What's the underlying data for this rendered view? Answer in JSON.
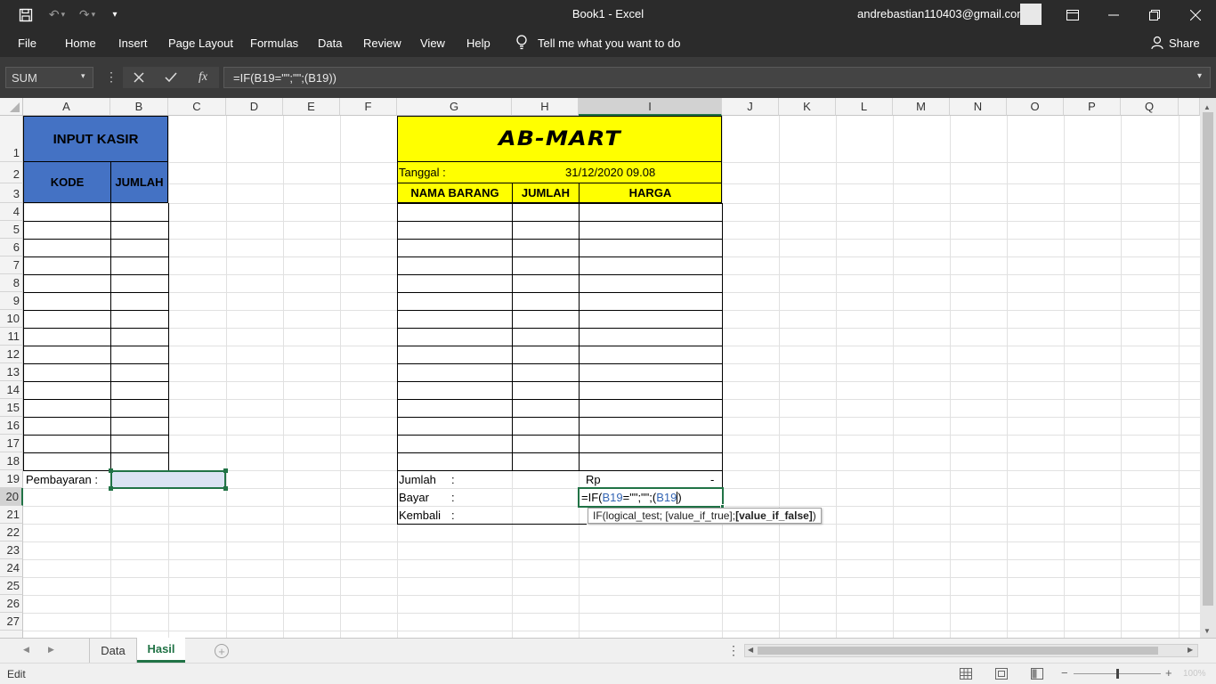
{
  "window": {
    "title": "Book1  -  Excel",
    "account": "andrebastian110403@gmail.com"
  },
  "ribbon": {
    "tabs": [
      "File",
      "Home",
      "Insert",
      "Page Layout",
      "Formulas",
      "Data",
      "Review",
      "View",
      "Help"
    ],
    "tell_me": "Tell me what you want to do",
    "share": "Share"
  },
  "formula_bar": {
    "name_box": "SUM",
    "fx": "fx",
    "formula": "=IF(B19=\"\";\"\";(B19))"
  },
  "columns": [
    "A",
    "B",
    "C",
    "D",
    "E",
    "F",
    "G",
    "H",
    "I",
    "J",
    "K",
    "L",
    "M",
    "N",
    "O",
    "P",
    "Q"
  ],
  "rows": [
    "1",
    "2",
    "3",
    "4",
    "5",
    "6",
    "7",
    "8",
    "9",
    "10",
    "11",
    "12",
    "13",
    "14",
    "15",
    "16",
    "17",
    "18",
    "19",
    "20",
    "21",
    "22",
    "23",
    "24",
    "25",
    "26",
    "27"
  ],
  "input_kasir": {
    "title": "INPUT KASIR",
    "col_kode": "KODE",
    "col_jumlah": "JUMLAH",
    "pembayaran_label": "Pembayaran :"
  },
  "receipt": {
    "store": "AB-MART",
    "tanggal_label": "Tanggal :",
    "tanggal_value": "31/12/2020 09.08",
    "col_nama": "NAMA BARANG",
    "col_jumlah": "JUMLAH",
    "col_harga": "HARGA",
    "jumlah_label": "Jumlah",
    "bayar_label": "Bayar",
    "kembali_label": "Kembali",
    "colon": ":",
    "rp": "Rp",
    "dash": "-",
    "edit_prefix": "=IF(",
    "edit_ref1": "B19",
    "edit_mid": "=\"\";\"\";(",
    "edit_ref2": "B19",
    "edit_suffix": ")",
    "tooltip_plain": "IF(logical_test; [value_if_true]; ",
    "tooltip_bold": "[value_if_false]",
    "tooltip_end": ")"
  },
  "sheets": [
    "Data",
    "Hasil"
  ],
  "active_sheet": "Hasil",
  "status": {
    "mode": "Edit",
    "zoom": "100%"
  },
  "colors": {
    "dark_chrome": "#2b2b2b",
    "header_blue": "#4472c4",
    "receipt_yellow": "#ffff00",
    "excel_green": "#217346",
    "selection_fill": "#dae3f3"
  }
}
